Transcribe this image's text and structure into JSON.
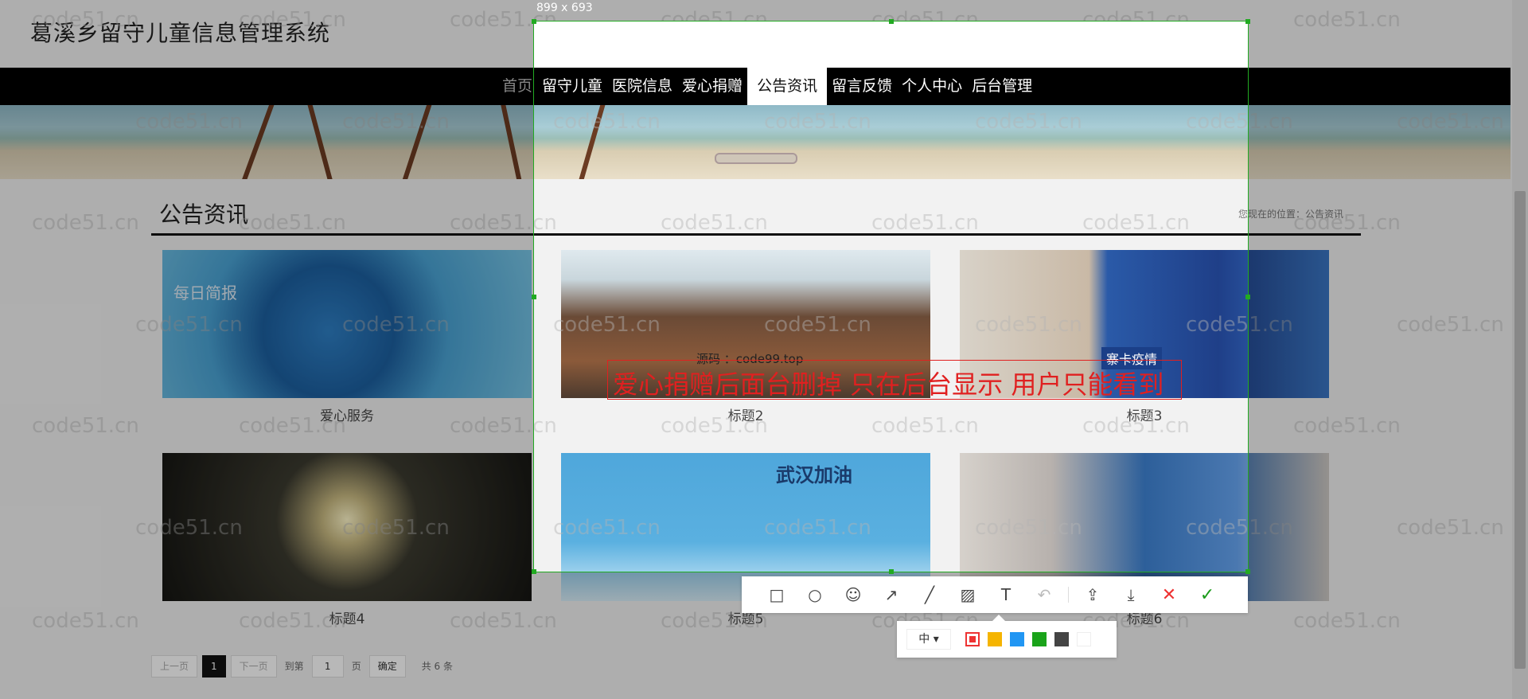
{
  "site_title": "葛溪乡留守儿童信息管理系统",
  "nav": {
    "items": [
      "首页",
      "留守儿童",
      "医院信息",
      "爱心捐赠",
      "公告资讯",
      "留言反馈",
      "个人中心",
      "后台管理"
    ],
    "active_index": 4
  },
  "section_title": "公告资讯",
  "breadcrumb": "您现在的位置：公告资讯",
  "cards": [
    {
      "caption": "爱心服务",
      "overlay_text": "每日简报"
    },
    {
      "caption": "标题2"
    },
    {
      "caption": "标题3",
      "overlay_text": "寨卡疫情"
    },
    {
      "caption": "标题4"
    },
    {
      "caption": "标题5",
      "overlay_text": "武汉加油"
    },
    {
      "caption": "标题6"
    }
  ],
  "pagination": {
    "prev": "上一页",
    "current": "1",
    "next": "下一页",
    "goto_prefix": "到第",
    "page_input": "1",
    "goto_suffix": "页",
    "confirm": "确定",
    "total": "共 6 条"
  },
  "capture": {
    "size_label": "899 x 693",
    "annotation_text": "爱心捐赠后面台删掉 只在后台显示 用户只能看到",
    "source_text": "源码 ：code99.top"
  },
  "toolbar": {
    "icons": [
      "rect-icon",
      "circle-icon",
      "mosaic-emoji-icon",
      "arrow-icon",
      "pen-icon",
      "blur-icon",
      "text-icon",
      "undo-icon",
      "share-icon",
      "download-icon",
      "cancel-icon",
      "confirm-icon"
    ],
    "size_option": "中"
  },
  "colors": {
    "swatches": [
      "#e33333",
      "#f5b400",
      "#2196f3",
      "#1aa31a",
      "#444444",
      "#ffffff"
    ],
    "capture_border": "#22aa22"
  },
  "watermark": "code51.cn"
}
